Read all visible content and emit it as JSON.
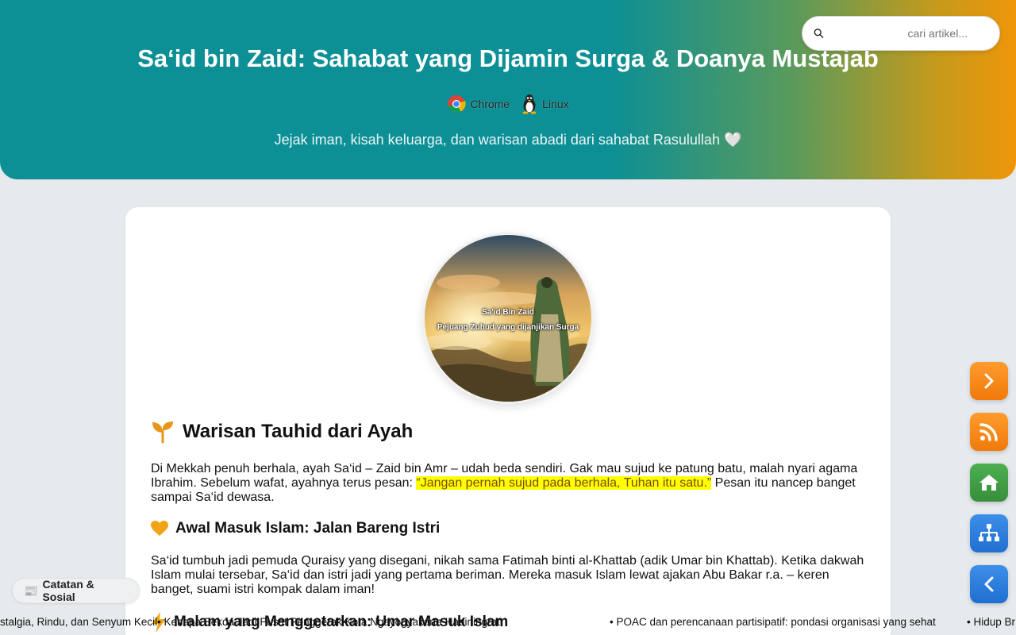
{
  "header": {
    "title": "Sa‘id bin Zaid: Sahabat yang Dijamin Surga & Doanya Mustajab",
    "badges": [
      {
        "icon": "chrome-icon",
        "label": "Chrome"
      },
      {
        "icon": "linux-icon",
        "label": "Linux"
      }
    ],
    "subtitle": "Jejak iman, kisah keluarga, dan warisan abadi dari sahabat Rasulullah 🤍",
    "gradient_colors": [
      "#0c8f95",
      "#f0960a"
    ]
  },
  "search": {
    "placeholder": "cari artikel...",
    "value": ""
  },
  "article": {
    "image_caption_title": "Sa'id Bin Zaid",
    "image_caption_sub": "Pejuang Zuhud yang dijanjikan Surga",
    "section1": {
      "heading": "Warisan Tauhid dari Ayah",
      "icon": "sprout-icon",
      "text_before": "Di Mekkah penuh berhala, ayah Sa‘id – Zaid bin Amr – udah beda sendiri. Gak mau sujud ke patung batu, malah nyari agama Ibrahim. Sebelum wafat, ayahnya terus pesan: ",
      "highlight": "“Jangan pernah sujud pada berhala, Tuhan itu satu.”",
      "text_after": " Pesan itu nancep banget sampai Sa‘id dewasa."
    },
    "section2": {
      "heading": "Awal Masuk Islam: Jalan Bareng Istri",
      "icon": "heart-icon",
      "text": "Sa‘id tumbuh jadi pemuda Quraisy yang disegani, nikah sama Fatimah binti al-Khattab (adik Umar bin Khattab). Ketika dakwah Islam mulai tersebar, Sa‘id dan istri jadi yang pertama beriman. Mereka masuk Islam lewat ajakan Abu Bakar r.a. – keren banget, suami istri kompak dalam iman!"
    },
    "section3": {
      "heading": "Malam yang Menggetarkan: Umar Masuk Islam",
      "icon": "lightning-icon"
    }
  },
  "fabs": [
    {
      "name": "next-button",
      "icon": "chevron-right-icon",
      "color": "#f7870f"
    },
    {
      "name": "rss-button",
      "icon": "rss-icon",
      "color": "#f7870f"
    },
    {
      "name": "home-button",
      "icon": "home-icon",
      "color": "#43a047"
    },
    {
      "name": "sitemap-button",
      "icon": "sitemap-icon",
      "color": "#2b7fe0"
    },
    {
      "name": "back-button",
      "icon": "chevron-left-icon",
      "color": "#2b7fe0"
    }
  ],
  "chip": {
    "icon": "newspaper-icon",
    "label": "Catatan & Sosial"
  },
  "ticker": [
    "stalgia, Rindu, dan Senyum Kecil",
    "• Kenapa Sekda Jadi Pusat Penggerak Kota Ngayogyakarta Hadiningrat",
    "• POAC dan perencanaan partisipatif: pondasi organisasi yang sehat",
    "• Hidup Br"
  ]
}
